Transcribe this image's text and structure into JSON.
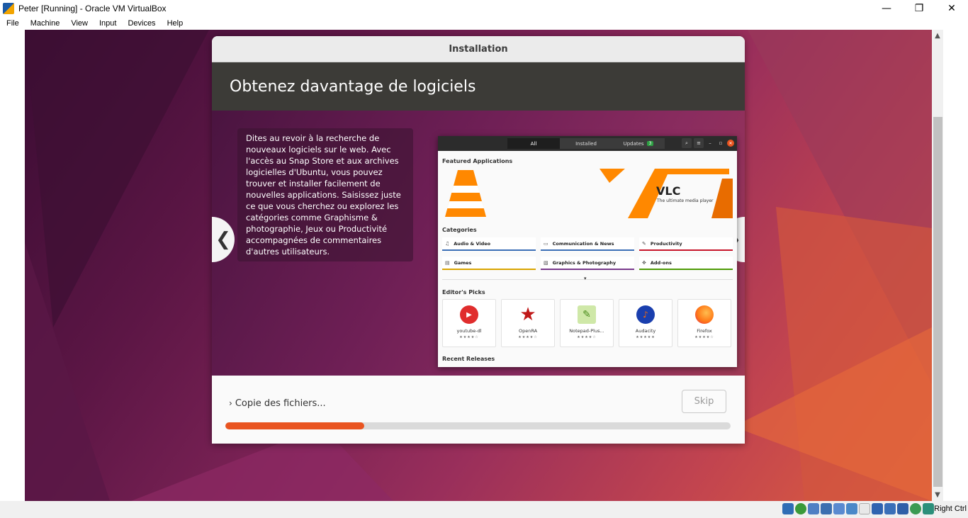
{
  "window": {
    "title": "Peter [Running] - Oracle VM VirtualBox",
    "controls": {
      "minimize": "—",
      "maximize": "❐",
      "close": "✕"
    }
  },
  "menu": [
    "File",
    "Machine",
    "View",
    "Input",
    "Devices",
    "Help"
  ],
  "statusbar": {
    "host_key": "Right Ctrl"
  },
  "installer": {
    "header_title": "Installation",
    "banner_title": "Obtenez davantage de logiciels",
    "slide_text": "Dites au revoir à la recherche de nouveaux logiciels sur le web. Avec l'accès au Snap Store et aux archives logicielles d'Ubuntu, vous pouvez trouver et installer facilement de nouvelles applications. Saisissez juste ce que vous cherchez ou explorez les catégories comme Graphisme & photographie, Jeux ou Productivité accompagnées de commentaires d'autres utilisateurs.",
    "prev_arrow": "❮",
    "next_arrow": "❯",
    "progress_status": "Copie des fichiers...",
    "skip_label": "Skip",
    "progress_percent": 27.5
  },
  "store": {
    "tabs": {
      "all": "All",
      "installed": "Installed",
      "updates": "Updates",
      "updates_count": "3"
    },
    "featured_heading": "Featured Applications",
    "featured_app": "VLC",
    "featured_tagline": "The ultimate media player",
    "categories_heading": "Categories",
    "categories": [
      {
        "label": "Audio & Video",
        "icon": "music-note-icon",
        "color": "#3b6fb6"
      },
      {
        "label": "Communication & News",
        "icon": "chat-icon",
        "color": "#3b6fb6"
      },
      {
        "label": "Productivity",
        "icon": "edit-icon",
        "color": "#c7162b"
      },
      {
        "label": "Games",
        "icon": "gamepad-icon",
        "color": "#d9a400"
      },
      {
        "label": "Graphics & Photography",
        "icon": "image-icon",
        "color": "#7a3a8c"
      },
      {
        "label": "Add-ons",
        "icon": "puzzle-icon",
        "color": "#4e9a06"
      }
    ],
    "editors_heading": "Editor's Picks",
    "picks": [
      {
        "name": "youtube-dl",
        "stars": "★★★★☆",
        "color": "#e02d2d"
      },
      {
        "name": "OpenRA",
        "stars": "★★★★☆",
        "color": "#c01818"
      },
      {
        "name": "Notepad-Plus...",
        "stars": "★★★★☆",
        "color": "#7cb342"
      },
      {
        "name": "Audacity",
        "stars": "★★★★★",
        "color": "#1a3fae"
      },
      {
        "name": "Firefox",
        "stars": "★★★★☆",
        "color": "#ff7a18"
      }
    ],
    "recent_heading": "Recent Releases"
  },
  "colors": {
    "accent": "#e95420",
    "banner": "#3c3b37"
  }
}
